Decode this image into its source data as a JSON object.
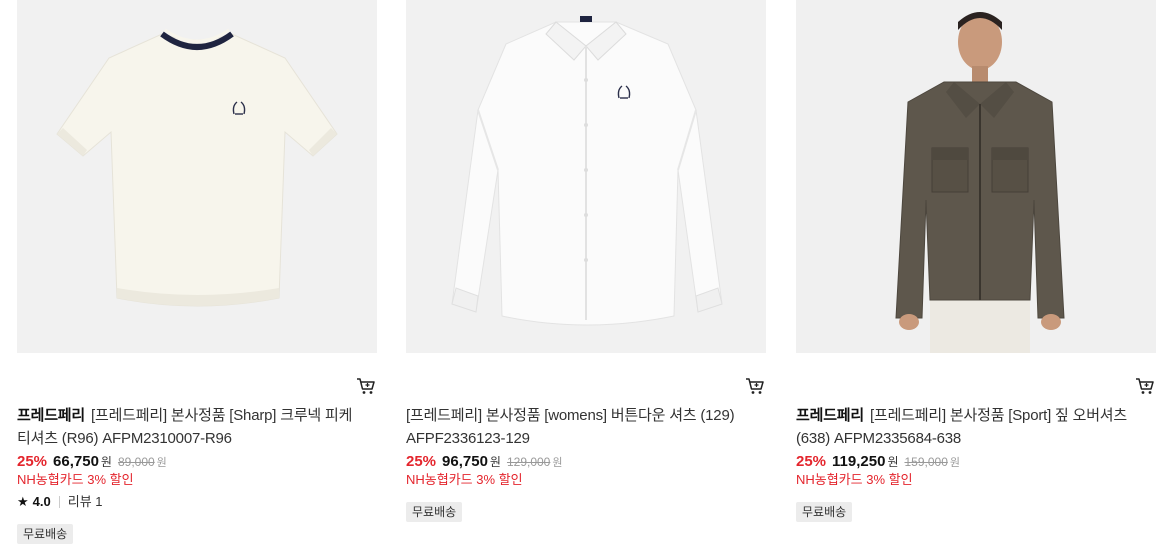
{
  "products": [
    {
      "brand": "프레드페리",
      "name": "[프레드페리] 본사정품 [Sharp] 크루넥 피케 티셔츠 (R96) AFPM2310007-R96",
      "discount": "25%",
      "price": "66,750",
      "currency": "원",
      "original_price": "89,000",
      "original_currency": "원",
      "card_promo": "NH농협카드 3% 할인",
      "rating": "4.0",
      "reviews": "리뷰 1",
      "badge": "무료배송",
      "image_label": "product-image-crewneck-tee",
      "cart_icon": "cart-icon"
    },
    {
      "brand": "",
      "name": "[프레드페리] 본사정품 [womens] 버튼다운 셔츠 (129) AFPF2336123-129",
      "discount": "25%",
      "price": "96,750",
      "currency": "원",
      "original_price": "129,000",
      "original_currency": "원",
      "card_promo": "NH농협카드 3% 할인",
      "badge": "무료배송",
      "image_label": "product-image-button-down-shirt",
      "cart_icon": "cart-icon"
    },
    {
      "brand": "프레드페리",
      "name": "[프레드페리] 본사정품 [Sport] 짚 오버셔츠 (638) AFPM2335684-638",
      "discount": "25%",
      "price": "119,250",
      "currency": "원",
      "original_price": "159,000",
      "original_currency": "원",
      "card_promo": "NH농협카드 3% 할인",
      "badge": "무료배송",
      "image_label": "product-image-zip-overshirt",
      "cart_icon": "cart-icon"
    }
  ],
  "colors": {
    "discount": "#e4252d",
    "promo": "#e4252d",
    "thumb_bg": "#f2f2f2",
    "badge_bg": "#ececec"
  }
}
